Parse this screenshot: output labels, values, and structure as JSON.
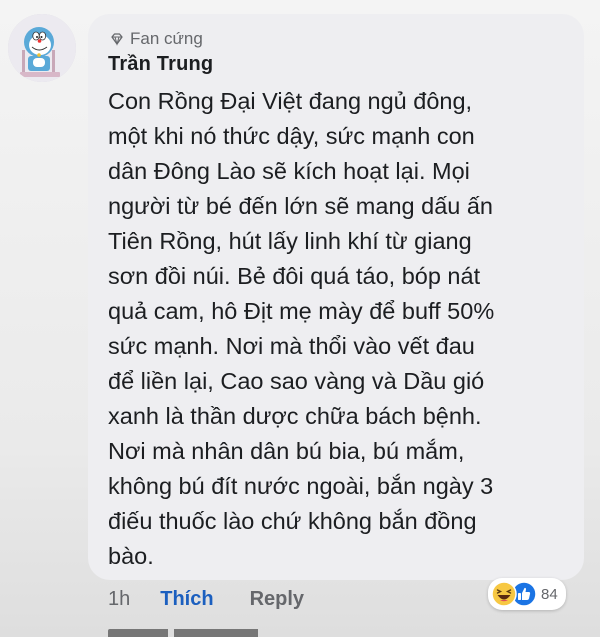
{
  "comment": {
    "badge": "Fan cứng",
    "author": "Trần Trung",
    "lines": [
      "Con Rồng Đại Việt đang ngủ đông,",
      "một khi nó thức dậy, sức mạnh con",
      "dân Đông Lào sẽ kích hoạt lại. Mọi",
      "người từ bé đến lớn sẽ mang dấu ấn",
      "Tiên Rồng, hút lấy linh khí từ giang",
      "sơn đồi núi. Bẻ đôi quá táo, bóp nát",
      "quả cam, hô Địt mẹ mày để buff 50%",
      "sức mạnh. Nơi mà thổi vào vết đau",
      "để liền lại, Cao sao vàng và Dầu gió",
      "xanh là thần dược chữa bách bệnh.",
      "Nơi mà nhân dân bú bia, bú mắm,",
      "không bú đít nước ngoài, bắn ngày 3",
      "điếu thuốc lào chứ không bắn đồng",
      "bào."
    ]
  },
  "actions": {
    "time": "1h",
    "like_label": "Thích",
    "reply_label": "Reply"
  },
  "reactions": {
    "icons": [
      "haha-icon",
      "like-icon"
    ],
    "count": "84"
  },
  "colors": {
    "bubble": "#eeeef1",
    "like_blue": "#1b5fbf",
    "meta_gray": "#65676b"
  }
}
